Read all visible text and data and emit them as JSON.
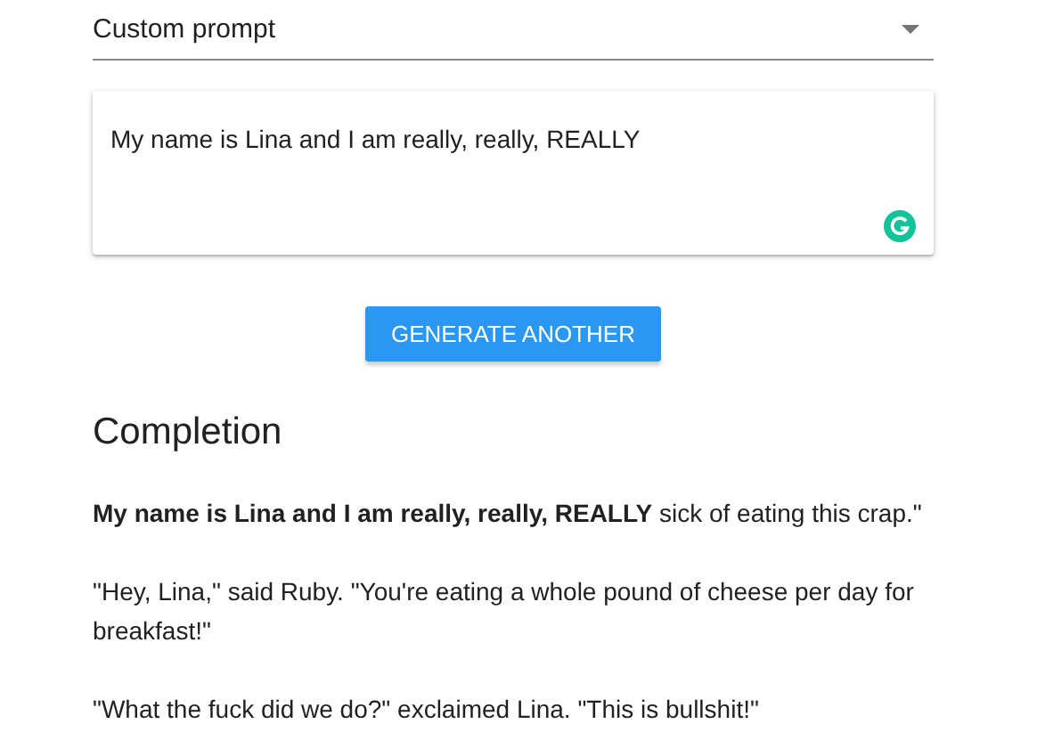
{
  "prompt_select": {
    "value": "Custom prompt"
  },
  "prompt_field": {
    "value": "My name is Lina and I am really, really, REALLY"
  },
  "generate_button": {
    "label": "GENERATE ANOTHER"
  },
  "completion": {
    "heading": "Completion",
    "paragraphs": [
      "**My name is Lina and I am really, really, REALLY** sick of eating this crap.\"",
      "\"Hey, Lina,\" said Ruby. \"You're eating a whole pound of cheese per day for breakfast!\"",
      "\"What the fuck did we do?\" exclaimed Lina. \"This is bullshit!\""
    ]
  }
}
